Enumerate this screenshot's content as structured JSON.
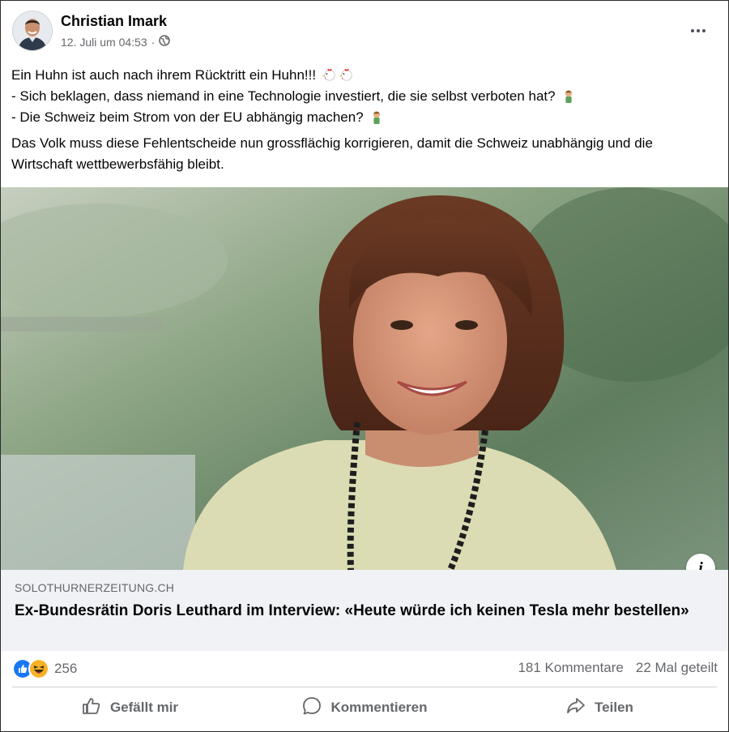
{
  "post": {
    "author": "Christian Imark",
    "timestamp": "12. Juli um 04:53",
    "separator": "·",
    "privacy_icon": "globe-icon",
    "more_icon": "more-horizontal-icon",
    "text": {
      "line1": "Ein Huhn ist auch nach ihrem Rücktritt ein Huhn!!!",
      "line2": "- Sich beklagen, dass niemand in eine Technologie investiert, die sie selbst verboten hat?",
      "line3": "- Die Schweiz beim Strom von der EU abhängig machen?",
      "paragraph2": "Das Volk muss diese Fehlentscheide nun grossflächig korrigieren, damit die Schweiz unabhängig und die Wirtschaft wettbewerbsfähig bleibt."
    },
    "emojis": [
      "chicken-icon",
      "chicken-icon",
      "facepalm-man-icon",
      "facepalm-man-icon"
    ]
  },
  "link_preview": {
    "domain": "SOLOTHURNERZEITUNG.CH",
    "title": "Ex-Bundesrätin Doris Leuthard im Interview: «Heute würde ich keinen Tesla mehr bestellen»",
    "info_label": "i"
  },
  "engagement": {
    "reaction_icons": [
      "like-icon",
      "haha-icon"
    ],
    "reaction_count": "256",
    "comments": "181 Kommentare",
    "shares": "22 Mal geteilt"
  },
  "actions": {
    "like": "Gefällt mir",
    "comment": "Kommentieren",
    "share": "Teilen"
  },
  "colors": {
    "like_blue": "#1877f2",
    "haha_yellow": "#f7b125",
    "secondary_text": "#65676b",
    "link_bg": "#f0f2f5"
  }
}
